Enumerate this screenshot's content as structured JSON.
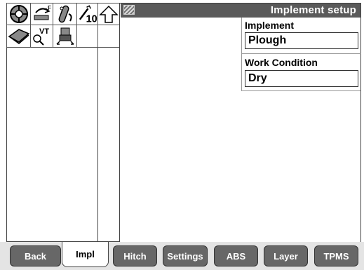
{
  "header": {
    "title": "Implement setup"
  },
  "icons": {
    "row1": [
      "tractor-wheel-icon",
      "pto-rotation-icon",
      "hitch-link-icon",
      "wrench-10-icon",
      "up-arrow-icon"
    ],
    "row2": [
      "book-search-icon",
      "vt-search-icon",
      "tractor-camera-icon"
    ],
    "wrench_badge": "10",
    "vt_badge": "VT"
  },
  "implement": {
    "label": "Implement",
    "value": "Plough"
  },
  "work_condition": {
    "label": "Work Condition",
    "value": "Dry"
  },
  "tabs": [
    {
      "label": "Back",
      "active": false
    },
    {
      "label": "Impl",
      "active": true
    },
    {
      "label": "Hitch",
      "active": false
    },
    {
      "label": "Settings",
      "active": false
    },
    {
      "label": "ABS",
      "active": false
    },
    {
      "label": "Layer",
      "active": false
    },
    {
      "label": "TPMS",
      "active": false
    }
  ]
}
